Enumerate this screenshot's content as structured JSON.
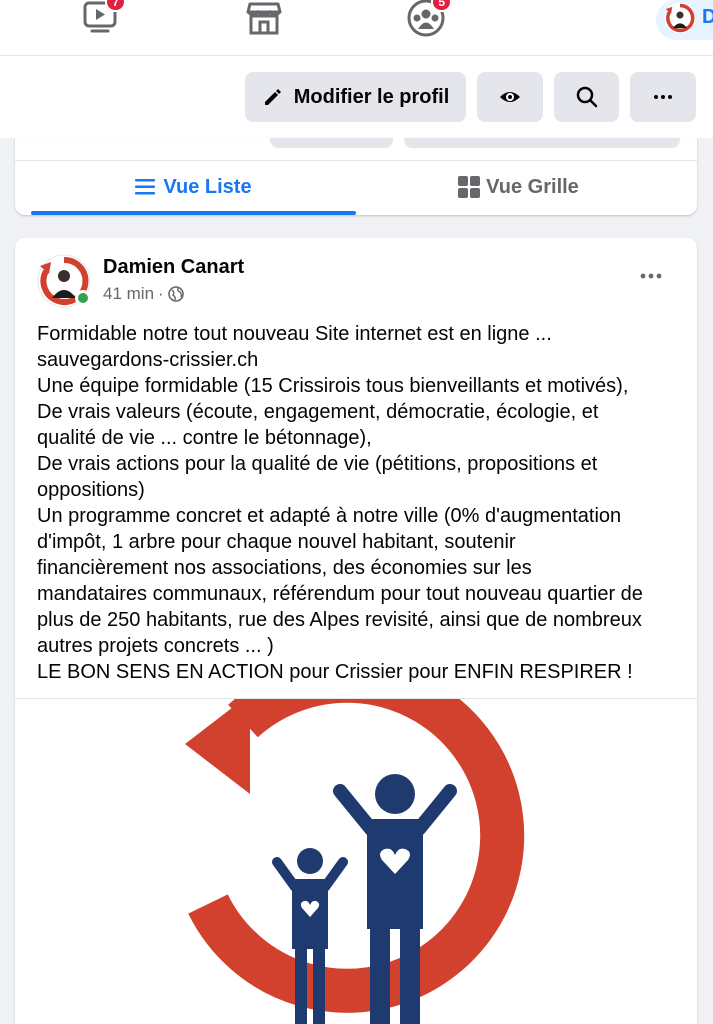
{
  "nav": {
    "items": [
      {
        "icon": "video-icon",
        "badge": "7"
      },
      {
        "icon": "marketplace-icon",
        "badge": ""
      },
      {
        "icon": "groups-icon",
        "badge": "5"
      }
    ],
    "profile_label": "D"
  },
  "actions": {
    "edit_label": "Modifier le profil",
    "view_icon": "eye-icon",
    "search_icon": "search-icon",
    "more_icon": "more-icon"
  },
  "tabs": {
    "list_label": "Vue Liste",
    "grid_label": "Vue Grille",
    "active": "list"
  },
  "post": {
    "author": "Damien Canart",
    "time": "41 min",
    "separator": "·",
    "audience_icon": "globe-icon",
    "lines": [
      "Formidable notre tout nouveau Site internet est en ligne ...",
      "sauvegardons-crissier.ch",
      "Une équipe formidable (15 Crissirois tous bienveillants et motivés),",
      "De vrais valeurs (écoute, engagement, démocratie, écologie, et",
      "qualité de vie ... contre le bétonnage),",
      "De vrais actions pour la qualité de vie (pétitions, propositions et",
      "oppositions)",
      "Un programme concret et adapté à notre ville (0% d'augmentation",
      "d'impôt, 1 arbre pour chaque nouvel habitant, soutenir",
      "financièrement nos associations, des économies sur les",
      "mandataires communaux, référendum pour tout nouveau quartier de",
      "plus de 250 habitants, rue des Alpes revisité, ainsi que de nombreux",
      "autres projets concrets ... )",
      "LE BON SENS EN ACTION pour Crissier pour ENFIN RESPIRER !"
    ]
  },
  "colors": {
    "accent": "#1877f2",
    "logo_red": "#d2412e",
    "logo_navy": "#1f3a6e",
    "online": "#31a24c",
    "badge": "#e41e3f"
  }
}
